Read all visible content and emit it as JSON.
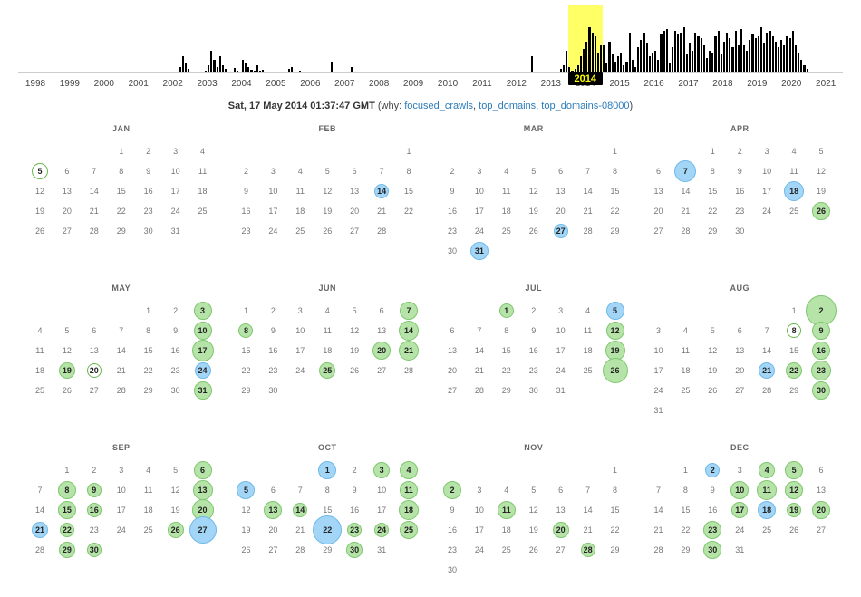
{
  "years": [
    "1998",
    "1999",
    "2000",
    "2001",
    "2002",
    "2003",
    "2004",
    "2005",
    "2006",
    "2007",
    "2008",
    "2009",
    "2010",
    "2011",
    "2012",
    "2013",
    "2014",
    "2015",
    "2016",
    "2017",
    "2018",
    "2019",
    "2020",
    "2021"
  ],
  "selected_year": "2014",
  "sparkline": {
    "1998": [],
    "1999": [],
    "2000": [],
    "2001": [],
    "2002": [
      0,
      0,
      0,
      0,
      0,
      0,
      0,
      0,
      6,
      18,
      10,
      4
    ],
    "2003": [
      0,
      0,
      0,
      0,
      0,
      2,
      8,
      24,
      14,
      6,
      18,
      8
    ],
    "2004": [
      4,
      0,
      0,
      5,
      2,
      0,
      14,
      10,
      6,
      3,
      2,
      8
    ],
    "2005": [
      2,
      3,
      0,
      0,
      0,
      0,
      0,
      0,
      0,
      0,
      4,
      6
    ],
    "2006": [
      0,
      0,
      2,
      0,
      0,
      0,
      0,
      0,
      0,
      0,
      0,
      0
    ],
    "2007": [
      0,
      12,
      0,
      0,
      0,
      0,
      0,
      0,
      6,
      0,
      0,
      0
    ],
    "2008": [],
    "2009": [],
    "2010": [],
    "2011": [],
    "2012": [
      0,
      0,
      0,
      0,
      0,
      0,
      0,
      0,
      0,
      0,
      0,
      18
    ],
    "2013": [
      0,
      0,
      0,
      0,
      0,
      0,
      0,
      0,
      0,
      4,
      8,
      24
    ],
    "2014": [
      6,
      2,
      4,
      8,
      18,
      26,
      34,
      50,
      44,
      40,
      22,
      30
    ],
    "2015": [
      30,
      10,
      34,
      20,
      12,
      18,
      22,
      8,
      12,
      44,
      14,
      6
    ],
    "2016": [
      28,
      36,
      44,
      32,
      18,
      22,
      24,
      14,
      42,
      46,
      48,
      10
    ],
    "2017": [
      28,
      46,
      42,
      44,
      50,
      20,
      32,
      24,
      44,
      40,
      38,
      30
    ],
    "2018": [
      16,
      24,
      22,
      40,
      46,
      20,
      34,
      44,
      38,
      28,
      46,
      30
    ],
    "2019": [
      48,
      30,
      24,
      36,
      42,
      38,
      40,
      50,
      32,
      44,
      46,
      40
    ],
    "2020": [
      34,
      28,
      36,
      30,
      40,
      38,
      46,
      30,
      22,
      14,
      8,
      4
    ],
    "2021": []
  },
  "header": {
    "timestamp": "Sat, 17 May 2014 01:37:47 GMT",
    "why_label": "why:",
    "links": [
      "focused_crawls",
      "top_domains",
      "top_domains-08000"
    ]
  },
  "months": [
    {
      "name": "JAN",
      "offset": 3,
      "days": 31,
      "marks": [
        {
          "d": 5,
          "c": "outline",
          "s": 16
        }
      ]
    },
    {
      "name": "FEB",
      "offset": 6,
      "days": 28,
      "marks": [
        {
          "d": 14,
          "c": "blue",
          "s": 14
        }
      ]
    },
    {
      "name": "MAR",
      "offset": 6,
      "days": 31,
      "marks": [
        {
          "d": 27,
          "c": "blue",
          "s": 14
        },
        {
          "d": 31,
          "c": "blue",
          "s": 18
        }
      ]
    },
    {
      "name": "APR",
      "offset": 2,
      "days": 30,
      "marks": [
        {
          "d": 7,
          "c": "blue",
          "s": 22
        },
        {
          "d": 18,
          "c": "blue",
          "s": 20
        },
        {
          "d": 26,
          "c": "green",
          "s": 18
        }
      ]
    },
    {
      "name": "MAY",
      "offset": 4,
      "days": 31,
      "marks": [
        {
          "d": 3,
          "c": "green",
          "s": 18
        },
        {
          "d": 10,
          "c": "green",
          "s": 18
        },
        {
          "d": 17,
          "c": "green",
          "s": 22
        },
        {
          "d": 19,
          "c": "green",
          "s": 16
        },
        {
          "d": 20,
          "c": "outline",
          "s": 14
        },
        {
          "d": 24,
          "c": "blue",
          "s": 16
        },
        {
          "d": 31,
          "c": "green",
          "s": 18
        }
      ]
    },
    {
      "name": "JUN",
      "offset": 0,
      "days": 30,
      "marks": [
        {
          "d": 7,
          "c": "green",
          "s": 18
        },
        {
          "d": 8,
          "c": "green",
          "s": 14
        },
        {
          "d": 14,
          "c": "green",
          "s": 20
        },
        {
          "d": 20,
          "c": "green",
          "s": 18
        },
        {
          "d": 21,
          "c": "green",
          "s": 20
        },
        {
          "d": 25,
          "c": "green",
          "s": 16
        }
      ]
    },
    {
      "name": "JUL",
      "offset": 2,
      "days": 31,
      "marks": [
        {
          "d": 1,
          "c": "green",
          "s": 14
        },
        {
          "d": 5,
          "c": "blue",
          "s": 18
        },
        {
          "d": 12,
          "c": "green",
          "s": 18
        },
        {
          "d": 19,
          "c": "green",
          "s": 20
        },
        {
          "d": 26,
          "c": "green",
          "s": 26
        }
      ]
    },
    {
      "name": "AUG",
      "offset": 5,
      "days": 31,
      "marks": [
        {
          "d": 2,
          "c": "green",
          "s": 32
        },
        {
          "d": 8,
          "c": "outline",
          "s": 14
        },
        {
          "d": 9,
          "c": "green",
          "s": 18
        },
        {
          "d": 16,
          "c": "green",
          "s": 18
        },
        {
          "d": 21,
          "c": "blue",
          "s": 16
        },
        {
          "d": 22,
          "c": "green",
          "s": 16
        },
        {
          "d": 23,
          "c": "green",
          "s": 20
        },
        {
          "d": 30,
          "c": "green",
          "s": 18
        }
      ]
    },
    {
      "name": "SEP",
      "offset": 1,
      "days": 30,
      "marks": [
        {
          "d": 6,
          "c": "green",
          "s": 18
        },
        {
          "d": 8,
          "c": "green",
          "s": 18
        },
        {
          "d": 9,
          "c": "green",
          "s": 14
        },
        {
          "d": 13,
          "c": "green",
          "s": 20
        },
        {
          "d": 15,
          "c": "green",
          "s": 18
        },
        {
          "d": 16,
          "c": "green",
          "s": 14
        },
        {
          "d": 20,
          "c": "green",
          "s": 22
        },
        {
          "d": 21,
          "c": "blue",
          "s": 16
        },
        {
          "d": 22,
          "c": "green",
          "s": 14
        },
        {
          "d": 26,
          "c": "green",
          "s": 16
        },
        {
          "d": 27,
          "c": "blue",
          "s": 28
        },
        {
          "d": 29,
          "c": "green",
          "s": 16
        },
        {
          "d": 30,
          "c": "green",
          "s": 14
        }
      ]
    },
    {
      "name": "OCT",
      "offset": 3,
      "days": 31,
      "marks": [
        {
          "d": 1,
          "c": "blue",
          "s": 18
        },
        {
          "d": 3,
          "c": "green",
          "s": 16
        },
        {
          "d": 4,
          "c": "green",
          "s": 18
        },
        {
          "d": 5,
          "c": "blue",
          "s": 18
        },
        {
          "d": 11,
          "c": "green",
          "s": 18
        },
        {
          "d": 13,
          "c": "green",
          "s": 18
        },
        {
          "d": 14,
          "c": "green",
          "s": 14
        },
        {
          "d": 18,
          "c": "green",
          "s": 20
        },
        {
          "d": 22,
          "c": "blue",
          "s": 30
        },
        {
          "d": 23,
          "c": "green",
          "s": 14
        },
        {
          "d": 24,
          "c": "green",
          "s": 14
        },
        {
          "d": 25,
          "c": "green",
          "s": 18
        },
        {
          "d": 30,
          "c": "green",
          "s": 16
        }
      ]
    },
    {
      "name": "NOV",
      "offset": 6,
      "days": 30,
      "marks": [
        {
          "d": 2,
          "c": "green",
          "s": 18
        },
        {
          "d": 11,
          "c": "green",
          "s": 18
        },
        {
          "d": 20,
          "c": "green",
          "s": 16
        },
        {
          "d": 28,
          "c": "green",
          "s": 14
        }
      ]
    },
    {
      "name": "DEC",
      "offset": 1,
      "days": 31,
      "marks": [
        {
          "d": 2,
          "c": "blue",
          "s": 14
        },
        {
          "d": 4,
          "c": "green",
          "s": 16
        },
        {
          "d": 5,
          "c": "green",
          "s": 18
        },
        {
          "d": 10,
          "c": "green",
          "s": 18
        },
        {
          "d": 11,
          "c": "green",
          "s": 20
        },
        {
          "d": 12,
          "c": "green",
          "s": 18
        },
        {
          "d": 17,
          "c": "green",
          "s": 16
        },
        {
          "d": 18,
          "c": "blue",
          "s": 18
        },
        {
          "d": 19,
          "c": "green",
          "s": 14
        },
        {
          "d": 20,
          "c": "green",
          "s": 18
        },
        {
          "d": 23,
          "c": "green",
          "s": 18
        },
        {
          "d": 30,
          "c": "green",
          "s": 18
        }
      ]
    }
  ]
}
